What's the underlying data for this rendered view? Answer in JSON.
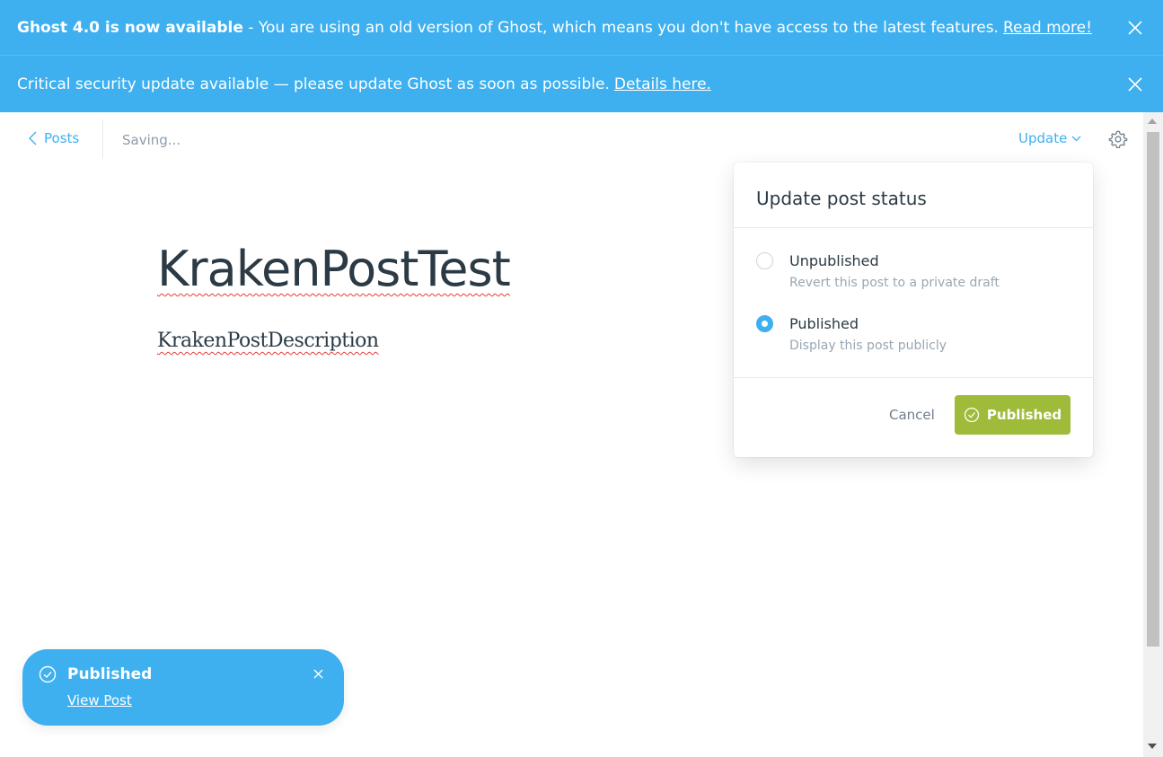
{
  "banners": [
    {
      "bold": "Ghost 4.0 is now available",
      "text": " - You are using an old version of Ghost, which means you don't have access to the latest features.",
      "link": "Read more!"
    },
    {
      "bold": "",
      "text": "Critical security update available — please update Ghost as soon as possible.",
      "link": "Details here."
    }
  ],
  "topbar": {
    "back_label": "Posts",
    "status": "Saving...",
    "update_label": "Update"
  },
  "editor": {
    "title": "KrakenPostTest",
    "description": "KrakenPostDescription"
  },
  "popover": {
    "title": "Update post status",
    "options": [
      {
        "label": "Unpublished",
        "sub": "Revert this post to a private draft",
        "checked": false
      },
      {
        "label": "Published",
        "sub": "Display this post publicly",
        "checked": true
      }
    ],
    "cancel_label": "Cancel",
    "confirm_label": "Published"
  },
  "toast": {
    "title": "Published",
    "link": "View Post"
  },
  "colors": {
    "accent": "#3eb0ef",
    "success": "#9fbb3a"
  }
}
